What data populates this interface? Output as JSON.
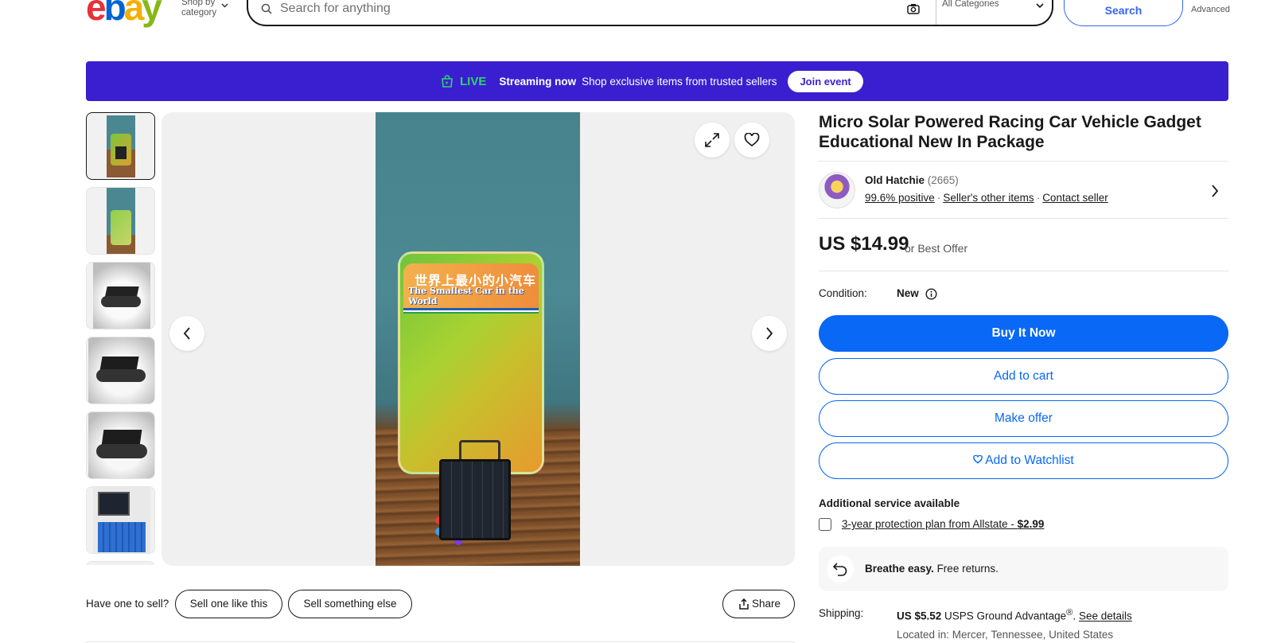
{
  "header": {
    "logo_letters": [
      "e",
      "b",
      "a",
      "y"
    ],
    "shop_by_line1": "Shop by",
    "shop_by_line2": "category",
    "search_placeholder": "Search for anything",
    "category_select": "All Categories",
    "search_button": "Search",
    "advanced_link": "Advanced"
  },
  "live_banner": {
    "tag": "LIVE",
    "streaming": "Streaming now",
    "message": "Shop exclusive items from trusted sellers",
    "join_button": "Join event",
    "background_color": "#3a1fd0",
    "live_color": "#2bd66b"
  },
  "gallery": {
    "thumbnail_count_visible": 6,
    "selected_index": 0,
    "package_text_cn": "世界上最小的小汽车",
    "package_text_en": "The Smallest Car in the World"
  },
  "sell_row": {
    "label": "Have one to sell?",
    "sell_like_this": "Sell one like this",
    "sell_else": "Sell something else",
    "share": "Share"
  },
  "listing": {
    "title": "Micro Solar Powered Racing Car Vehicle Gadget Educational New In Package",
    "seller_name": "Old Hatchie",
    "seller_feedback_count": "(2665)",
    "seller_positive": "99.6% positive",
    "seller_other_items": "Seller's other items",
    "contact_seller": "Contact seller",
    "price": "US $14.99",
    "best_offer": "or Best Offer",
    "condition_label": "Condition:",
    "condition_value": "New",
    "buy_now": "Buy It Now",
    "add_to_cart": "Add to cart",
    "make_offer": "Make offer",
    "add_to_watchlist": "Add to Watchlist",
    "additional_service": "Additional service available",
    "protection_plan": "3-year protection plan from Allstate - ",
    "protection_price": "$2.99",
    "returns_bold": "Breathe easy.",
    "returns_text": " Free returns.",
    "shipping_label": "Shipping:",
    "shipping_price": "US $5.52",
    "shipping_service": " USPS Ground Advantage",
    "shipping_reg": "®",
    "shipping_period": ". ",
    "see_details": "See details",
    "located_in": "Located in: Mercer, Tennessee, United States",
    "accent_color": "#0968f6"
  }
}
